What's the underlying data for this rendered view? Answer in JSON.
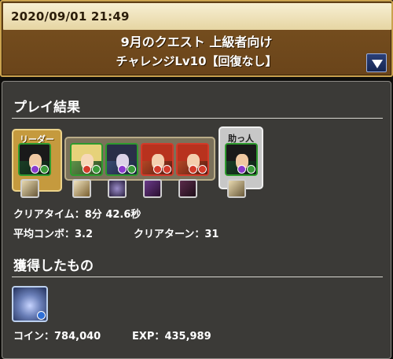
{
  "header": {
    "timestamp": "2020/09/01 21:49",
    "quest_title": "9月のクエスト 上級者向け",
    "quest_subtitle": "チャレンジLv10【回復なし】",
    "dropdown_icon": "triangle-down-icon"
  },
  "results": {
    "section_title": "プレイ結果",
    "leader_label": "リーダー",
    "helper_label": "助っ人",
    "clear_time_label": "クリアタイム：",
    "clear_time_value": "8分 42.6秒",
    "avg_combo_label": "平均コンボ：",
    "avg_combo_value": "3.2",
    "clear_turns_label": "クリアターン：",
    "clear_turns_value": "31"
  },
  "team": {
    "leader": {
      "attribute": "wood",
      "sub_attribute": "dark",
      "assist": "yes"
    },
    "subs": [
      {
        "attribute": "wood",
        "sub_attribute": "fire",
        "assist": "yes"
      },
      {
        "attribute": "wood",
        "sub_attribute": "dark",
        "assist": "yes"
      },
      {
        "attribute": "fire",
        "sub_attribute": "fire",
        "assist": "yes"
      },
      {
        "attribute": "fire",
        "sub_attribute": "fire",
        "assist": "yes"
      }
    ],
    "helper": {
      "attribute": "wood",
      "sub_attribute": "dark",
      "assist": "yes"
    }
  },
  "rewards": {
    "section_title": "獲得したもの",
    "coin_label": "コイン：",
    "coin_value": "784,040",
    "exp_label": "EXP：",
    "exp_value": "435,989"
  },
  "colors": {
    "header_bg": "#6e4619",
    "header_border": "#caa24e",
    "panel_bg": "#3b3a37",
    "leader_frame": "#c59a3e",
    "helper_frame": "#c7c7c7"
  }
}
